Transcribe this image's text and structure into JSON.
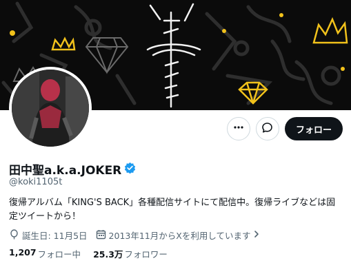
{
  "profile": {
    "display_name": "田中聖a.k.a.JOKER",
    "handle": "@koki1105t",
    "bio": "復帰アルバム「KING'S BACK」各種配信サイトにて配信中。復帰ライブなどは固定ツイートから！",
    "birthday": "誕生日: 11月5日",
    "joined": "2013年11月からXを利用しています",
    "following_count": "1,207",
    "following_label": "フォロー中",
    "followers_count": "25.3万",
    "followers_label": "フォロワー"
  },
  "actions": {
    "follow_label": "フォロー"
  },
  "icons": {
    "more": "more-icon",
    "message": "message-icon",
    "verified": "verified-badge-icon",
    "birthday": "balloon-icon",
    "calendar": "calendar-icon",
    "chevron": "chevron-right-icon"
  },
  "colors": {
    "primary_text": "#0f1419",
    "secondary_text": "#536471",
    "verified": "#1d9bf0",
    "banner_accent": "#f2c21b",
    "button_dark": "#0f1419",
    "border": "#cfd9de"
  }
}
